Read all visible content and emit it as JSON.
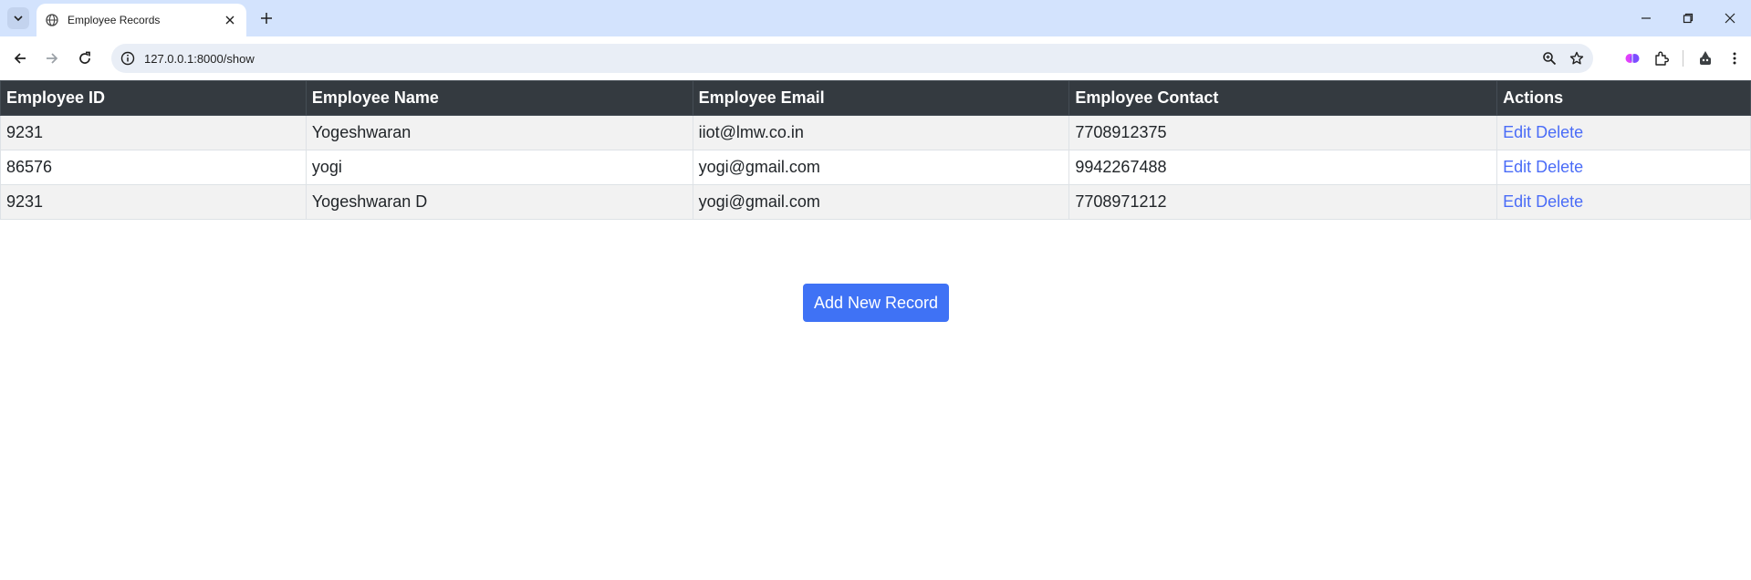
{
  "browser": {
    "tab_title": "Employee Records",
    "url": "127.0.0.1:8000/show"
  },
  "table": {
    "headers": [
      "Employee ID",
      "Employee Name",
      "Employee Email",
      "Employee Contact",
      "Actions"
    ],
    "rows": [
      {
        "id": "9231",
        "name": "Yogeshwaran",
        "email": "iiot@lmw.co.in",
        "contact": "7708912375",
        "edit": "Edit",
        "delete": "Delete"
      },
      {
        "id": "86576",
        "name": "yogi",
        "email": "yogi@gmail.com",
        "contact": "9942267488",
        "edit": "Edit",
        "delete": "Delete"
      },
      {
        "id": "9231",
        "name": "Yogeshwaran D",
        "email": "yogi@gmail.com",
        "contact": "7708971212",
        "edit": "Edit",
        "delete": "Delete"
      }
    ]
  },
  "add_button_label": "Add New Record",
  "colors": {
    "header_bg": "#343a40",
    "link": "#4a6cf7",
    "button": "#3f72f5",
    "tabbar": "#d3e3fd"
  }
}
